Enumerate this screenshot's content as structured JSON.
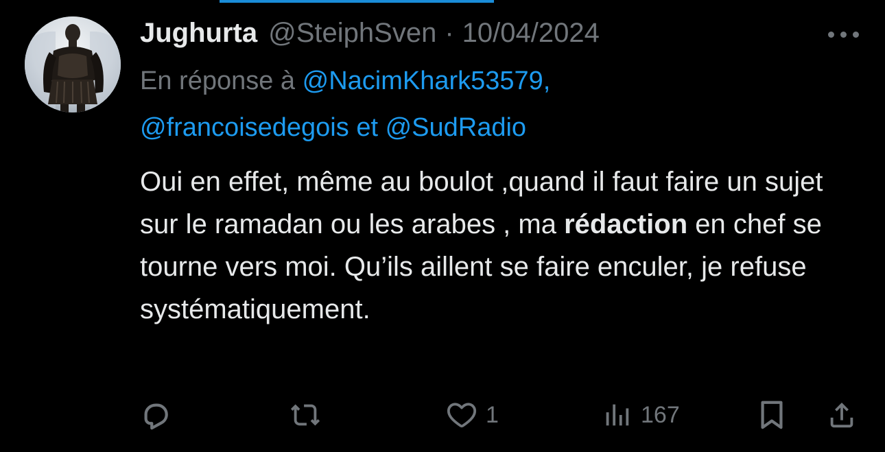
{
  "author": {
    "display_name": "Jughurta",
    "handle": "@SteiphSven",
    "separator": "·",
    "date": "10/04/2024",
    "avatar_icon": "statue-avatar"
  },
  "reply_context": {
    "prefix": "En réponse à",
    "mentions": [
      "@NacimKhark53579,",
      "@francoisedegois",
      "@SudRadio"
    ],
    "conjunction": "et"
  },
  "tweet": {
    "text_part1": "Oui en effet, même au boulot ,quand il faut faire un sujet sur le ramadan ou les arabes , ma ",
    "text_bold": "rédaction",
    "text_part2": " en chef se tourne vers moi. Qu’ils aillent se faire enculer, je refuse systématiquement."
  },
  "actions": {
    "reply": {
      "icon": "reply-icon",
      "count": ""
    },
    "retweet": {
      "icon": "retweet-icon",
      "count": ""
    },
    "like": {
      "icon": "heart-icon",
      "count": "1"
    },
    "views": {
      "icon": "views-icon",
      "count": "167"
    },
    "bookmark": {
      "icon": "bookmark-icon"
    },
    "share": {
      "icon": "share-icon"
    }
  },
  "colors": {
    "background": "#000000",
    "text": "#e7e9ea",
    "secondary": "#71767b",
    "accent": "#1d9bf0"
  },
  "menu": {
    "icon": "more-options-icon"
  }
}
